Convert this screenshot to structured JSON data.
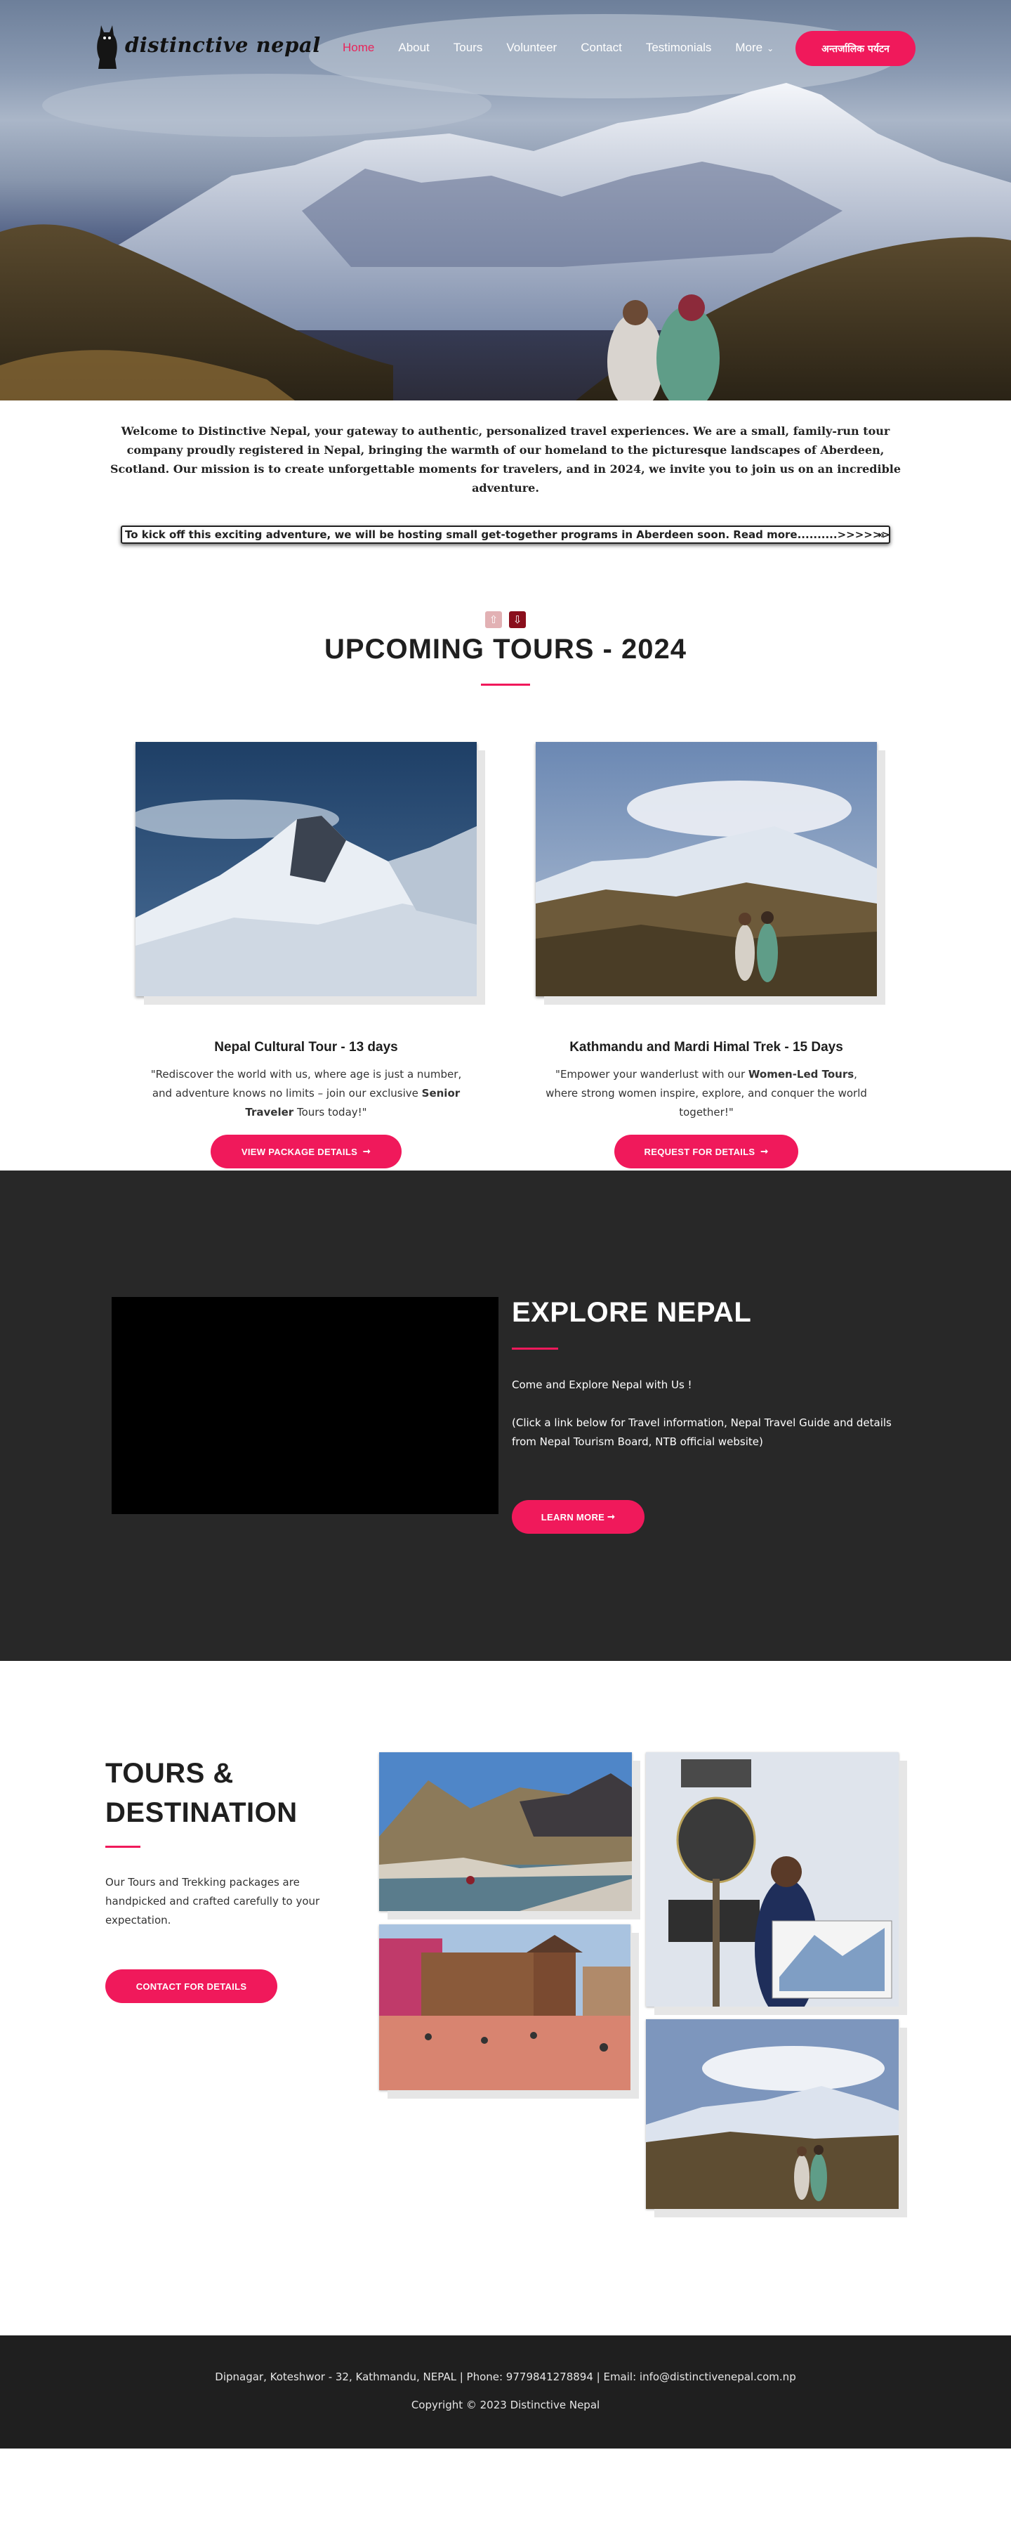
{
  "nav": {
    "brand": "distinctive nepal",
    "items": [
      {
        "label": "Home",
        "active": true
      },
      {
        "label": "About"
      },
      {
        "label": "Tours"
      },
      {
        "label": "Volunteer"
      },
      {
        "label": "Contact"
      },
      {
        "label": "Testimonials"
      },
      {
        "label": "More",
        "has_dropdown": true
      }
    ],
    "cta_label": "अन्तर्जालिक पर्यटन"
  },
  "intro": {
    "text": "Welcome to Distinctive Nepal, your gateway to authentic, personalized travel experiences. We are a small, family-run tour company proudly registered in Nepal, bringing the warmth of our homeland to the picturesque landscapes of Aberdeen, Scotland. Our mission is to create unforgettable moments for travelers, and in 2024, we invite you to join us on an incredible adventure.",
    "ticker": "To kick off this exciting adventure, we will be hosting small get-together programs in Aberdeen soon. Read more..........>>>>>>>>>>",
    "ticker_icon": "»"
  },
  "upcoming": {
    "title": "UPCOMING TOURS - 2024",
    "cards": [
      {
        "title": "Nepal Cultural Tour - 13 days",
        "text_before": "\"Rediscover the world with us, where age is just a number, and adventure knows no limits – join our exclusive ",
        "text_bold": "Senior Traveler",
        "text_after": " Tours today!\"",
        "button": "VIEW PACKAGE DETAILS",
        "arrow": "➞"
      },
      {
        "title": "Kathmandu and Mardi Himal Trek - 15 Days",
        "text_before": "\"Empower your wanderlust with our ",
        "text_bold": "Women-Led Tours",
        "text_after": ", where strong women inspire, explore, and conquer the world together!\"",
        "button": "REQUEST FOR DETAILS",
        "arrow": "➞"
      }
    ]
  },
  "explore": {
    "title": "EXPLORE NEPAL",
    "line1": "Come and Explore Nepal with Us !",
    "line2": "(Click a link below for Travel information, Nepal Travel Guide and details from Nepal Tourism Board, NTB official website)",
    "button": "LEARN MORE",
    "arrow": "➞"
  },
  "destination": {
    "title": "TOURS & DESTINATION",
    "text": "Our Tours and Trekking packages are handpicked and crafted carefully to your expectation.",
    "button": "CONTACT FOR DETAILS"
  },
  "footer": {
    "contact": "Dipnagar, Koteshwor - 32, Kathmandu, NEPAL | Phone: 9779841278894 | Email: info@distinctivenepal.com.np",
    "copyright": "Copyright © 2023 Distinctive Nepal"
  },
  "colors": {
    "accent": "#f0195b",
    "dark_section": "#282828",
    "footer": "#1f1f1f"
  }
}
